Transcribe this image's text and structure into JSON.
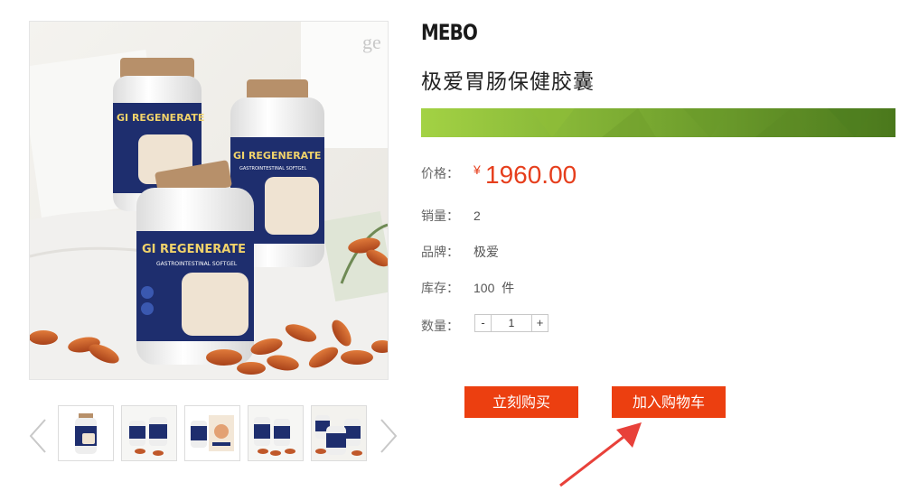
{
  "product": {
    "brand_logo_text": "MEBO",
    "title": "极爱胃肠保健胶囊",
    "price_label": "价格：",
    "currency_symbol": "¥",
    "price": "1960.00",
    "sales_label": "销量：",
    "sales": "2",
    "brand_label": "品牌：",
    "brand": "极爱",
    "stock_label": "库存：",
    "stock": "100  件",
    "qty_label": "数量：",
    "qty_minus": "-",
    "qty_value": "1",
    "qty_plus": "+"
  },
  "actions": {
    "buy_now": "立刻购买",
    "add_to_cart": "加入购物车"
  },
  "gallery": {
    "bottle_label_main": "GI REGENERATE",
    "bottle_label_sub": "GASTROINTESTINAL SOFTGEL",
    "thumbnail_count": 5
  },
  "colors": {
    "accent_red": "#ec3f10",
    "price_red": "#e63e1c",
    "banner_green_light": "#9ccc3c",
    "banner_green_dark": "#4d7b1f",
    "bottle_navy": "#1e2e6e"
  }
}
